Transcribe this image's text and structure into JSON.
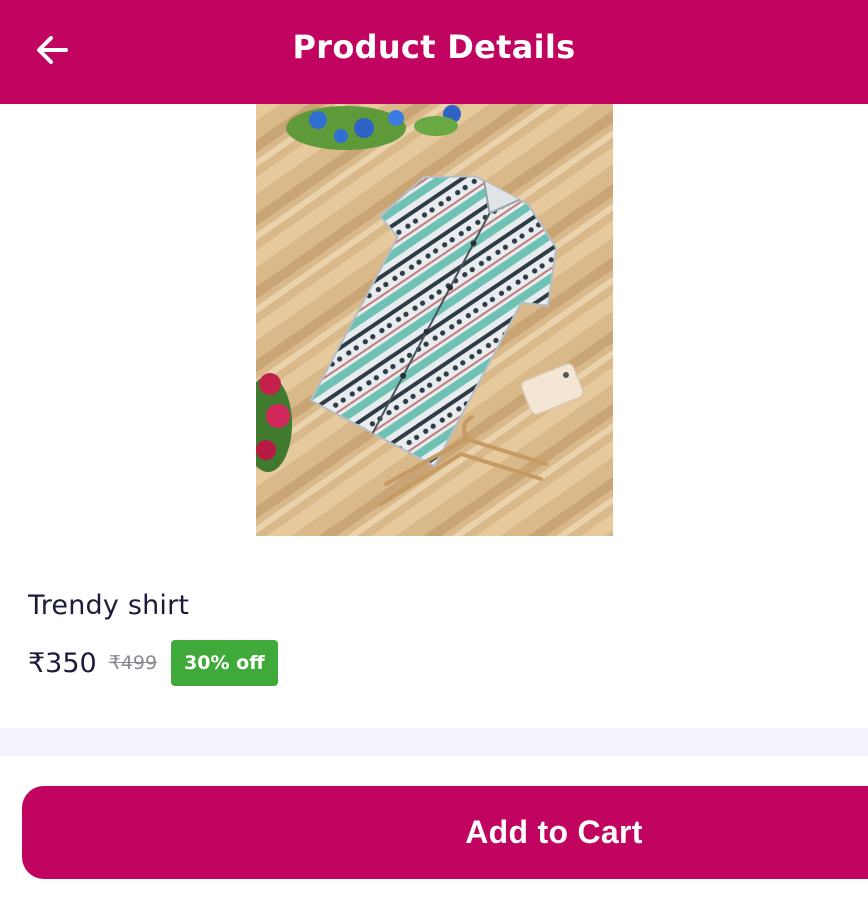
{
  "header": {
    "title": "Product Details",
    "back_icon": "arrow-left-icon"
  },
  "product": {
    "image_alt": "Trendy shirt",
    "name": "Trendy shirt",
    "price": "₹350",
    "original_price": "₹499",
    "discount": "30% off"
  },
  "actions": {
    "add_to_cart": "Add to Cart"
  },
  "colors": {
    "brand": "#c1045f",
    "discount_badge": "#3faa3a",
    "text": "#1a1c3a"
  }
}
